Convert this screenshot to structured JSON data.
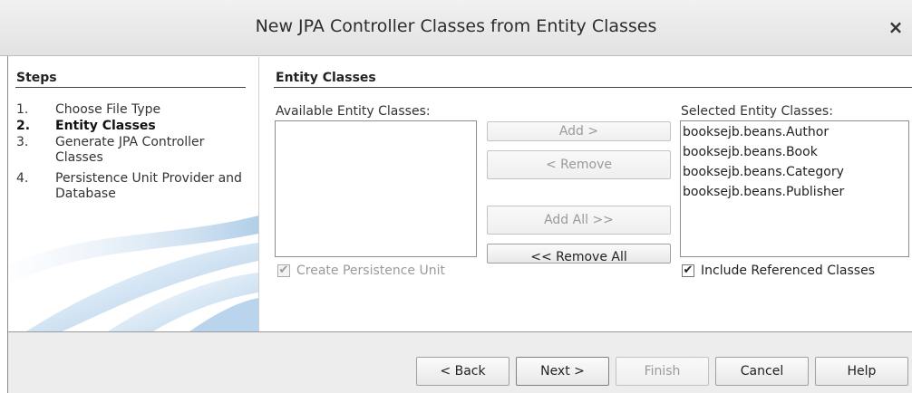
{
  "window": {
    "title": "New JPA Controller Classes from Entity Classes",
    "close_glyph": "×"
  },
  "steps": {
    "header": "Steps",
    "items": [
      {
        "num": "1.",
        "label": "Choose File Type"
      },
      {
        "num": "2.",
        "label": "Entity Classes"
      },
      {
        "num": "3.",
        "label": "Generate JPA Controller Classes"
      },
      {
        "num": "4.",
        "label": "Persistence Unit Provider and Database"
      }
    ],
    "current_index": 1
  },
  "content": {
    "header": "Entity Classes",
    "available": {
      "label": "Available Entity Classes:",
      "items": []
    },
    "selected": {
      "label": "Selected Entity Classes:",
      "items": [
        "booksejb.beans.Author",
        "booksejb.beans.Book",
        "booksejb.beans.Category",
        "booksejb.beans.Publisher"
      ]
    },
    "buttons": {
      "add": "Add >",
      "remove": "< Remove",
      "add_all": "Add All >>",
      "remove_all": "<< Remove All"
    },
    "create_persistence_unit": {
      "label": "Create Persistence Unit",
      "checked": true,
      "enabled": false
    },
    "include_referenced": {
      "label": "Include Referenced Classes",
      "checked": true,
      "enabled": true
    }
  },
  "footer": {
    "back": "< Back",
    "next": "Next >",
    "finish": "Finish",
    "cancel": "Cancel",
    "help": "Help"
  },
  "icons": {
    "check": "✔"
  }
}
